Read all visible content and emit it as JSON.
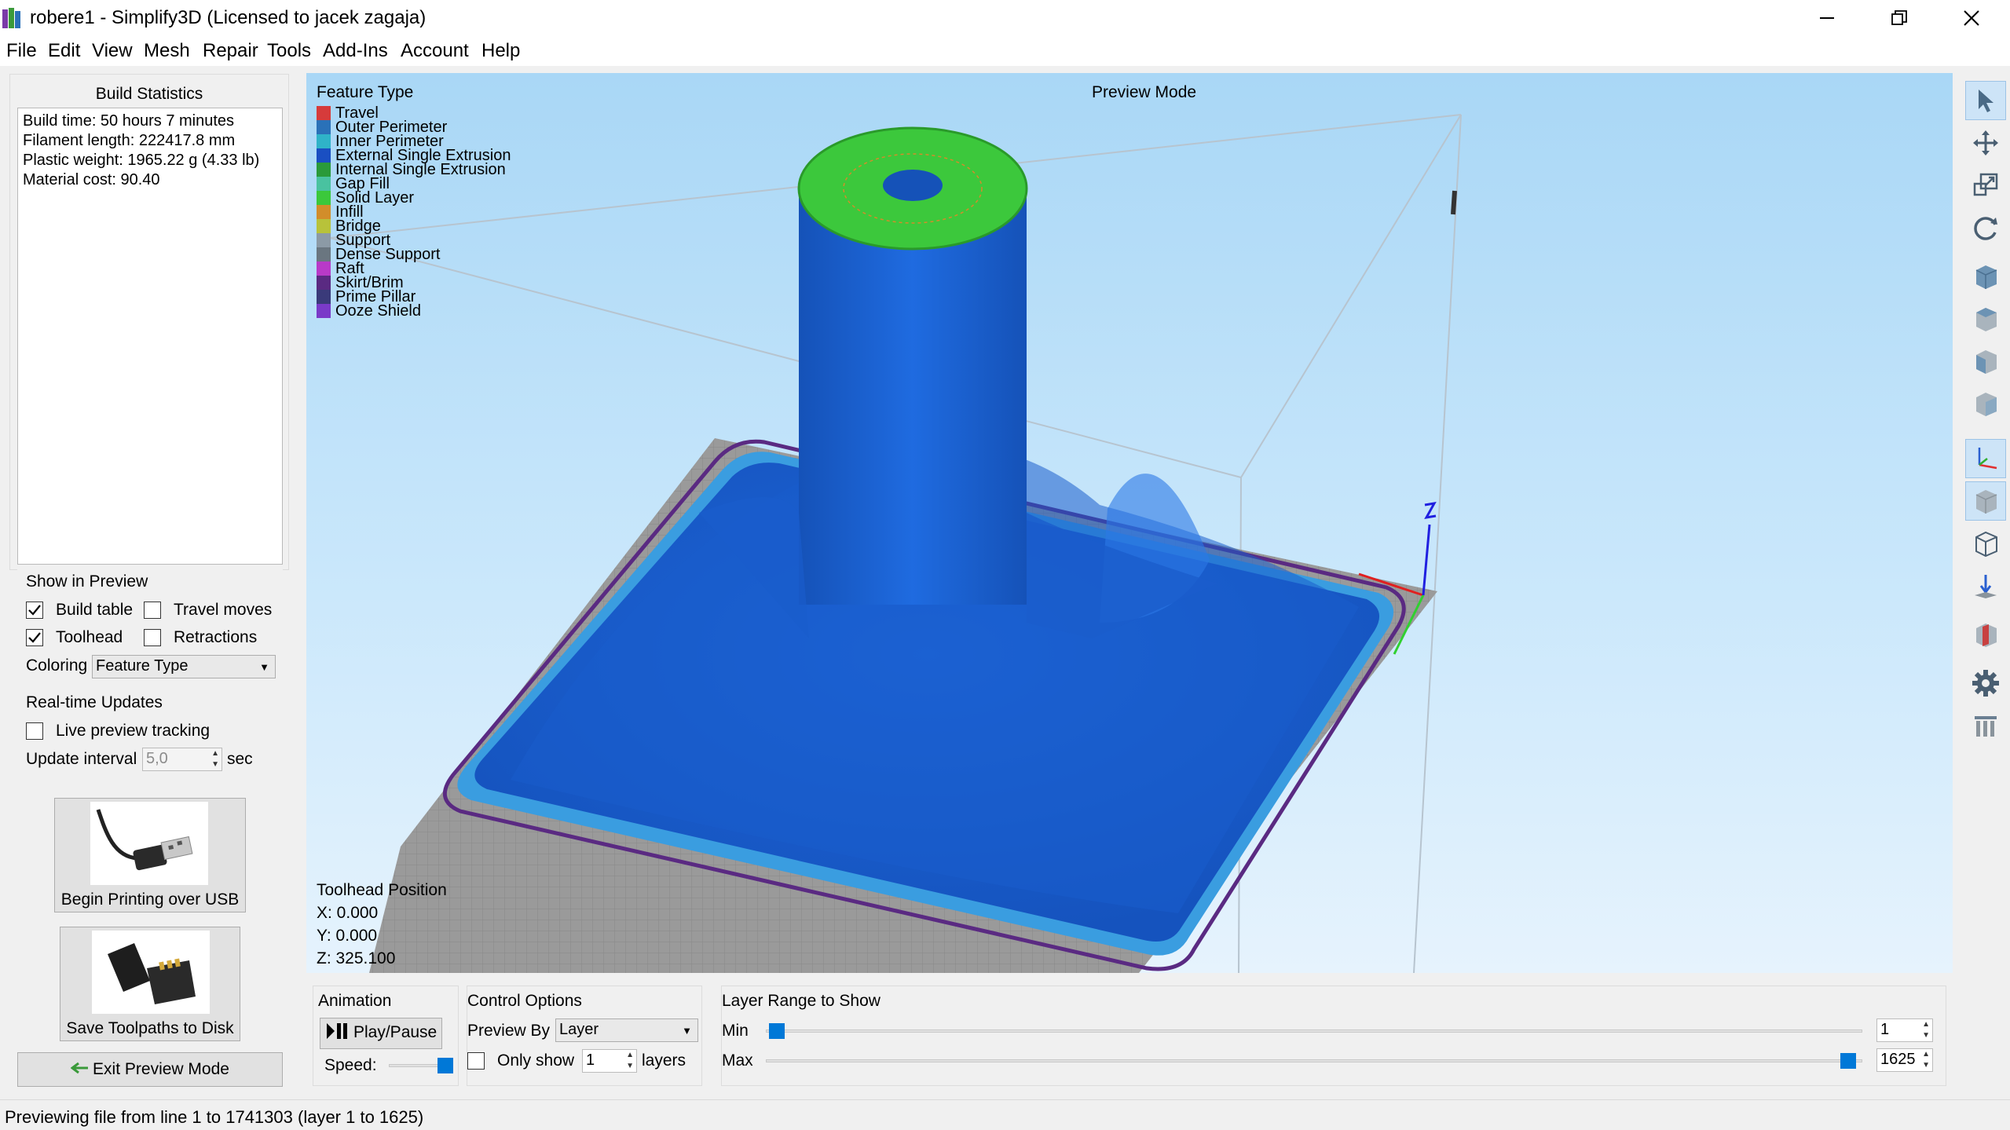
{
  "window": {
    "title": "robere1 - Simplify3D (Licensed to jacek zagaja)"
  },
  "menu": [
    "File",
    "Edit",
    "View",
    "Mesh",
    "Repair",
    "Tools",
    "Add-Ins",
    "Account",
    "Help"
  ],
  "build_statistics": {
    "title": "Build Statistics",
    "build_time": "Build time: 50 hours 7 minutes",
    "filament_length": "Filament length: 222417.8 mm",
    "plastic_weight": "Plastic weight: 1965.22 g (4.33 lb)",
    "material_cost": "Material cost: 90.40"
  },
  "show_in_preview": {
    "title": "Show in Preview",
    "build_table": {
      "label": "Build table",
      "checked": true
    },
    "travel_moves": {
      "label": "Travel moves",
      "checked": false
    },
    "toolhead": {
      "label": "Toolhead",
      "checked": true
    },
    "retractions": {
      "label": "Retractions",
      "checked": false
    },
    "coloring_label": "Coloring",
    "coloring_value": "Feature Type"
  },
  "realtime": {
    "title": "Real-time Updates",
    "live_tracking": {
      "label": "Live preview tracking",
      "checked": false
    },
    "update_interval_label": "Update interval",
    "update_interval_value": "5,0",
    "unit": "sec"
  },
  "buttons": {
    "usb": "Begin Printing over USB",
    "disk": "Save Toolpaths to Disk",
    "exit": "Exit Preview Mode"
  },
  "legend": {
    "title": "Feature Type",
    "items": [
      {
        "label": "Travel",
        "color": "#d63b3b"
      },
      {
        "label": "Outer Perimeter",
        "color": "#2a71b8"
      },
      {
        "label": "Inner Perimeter",
        "color": "#2fb3c8"
      },
      {
        "label": "External Single Extrusion",
        "color": "#1a4fc2"
      },
      {
        "label": "Internal Single Extrusion",
        "color": "#2a9a3a"
      },
      {
        "label": "Gap Fill",
        "color": "#49c2a0"
      },
      {
        "label": "Solid Layer",
        "color": "#3bc83b"
      },
      {
        "label": "Infill",
        "color": "#d28d2a"
      },
      {
        "label": "Bridge",
        "color": "#b8c23a"
      },
      {
        "label": "Support",
        "color": "#8c9aa6"
      },
      {
        "label": "Dense Support",
        "color": "#6a7680"
      },
      {
        "label": "Raft",
        "color": "#b83ac8"
      },
      {
        "label": "Skirt/Brim",
        "color": "#5a2a82"
      },
      {
        "label": "Prime Pillar",
        "color": "#3a3a7a"
      },
      {
        "label": "Ooze Shield",
        "color": "#7a3ac8"
      }
    ]
  },
  "viewport": {
    "mode": "Preview Mode",
    "toolhead_title": "Toolhead Position",
    "x": "X: 0.000",
    "y": "Y: 0.000",
    "z": "Z: 325.100"
  },
  "animation": {
    "title": "Animation",
    "play_label": "Play/Pause",
    "speed_label": "Speed:"
  },
  "control_options": {
    "title": "Control Options",
    "preview_by_label": "Preview By",
    "preview_by_value": "Layer",
    "only_show_label": "Only show",
    "only_show_value": "1",
    "layers_label": "layers"
  },
  "layer_range": {
    "title": "Layer Range to Show",
    "min_label": "Min",
    "min_value": "1",
    "max_label": "Max",
    "max_value": "1625"
  },
  "status": "Previewing file from line 1 to 1741303 (layer 1 to 1625)",
  "colors": {
    "accent": "#0078d7",
    "part_blue": "#1a5fcf",
    "top_green": "#3bc83b"
  }
}
